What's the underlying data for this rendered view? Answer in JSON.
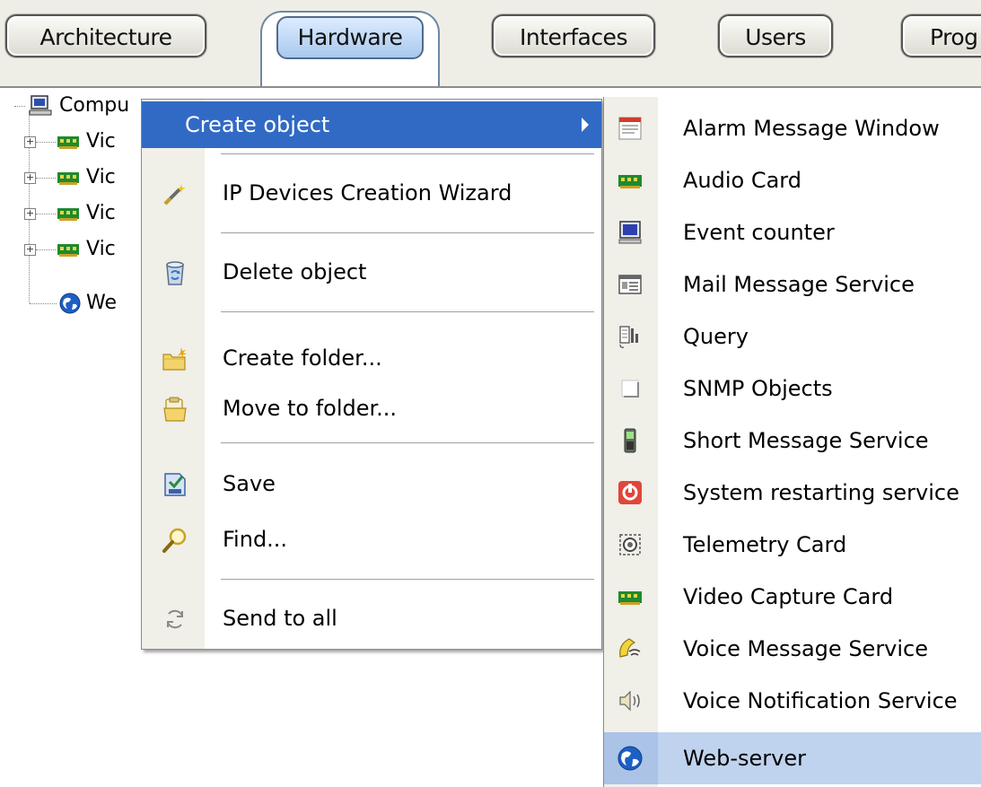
{
  "tabs": [
    {
      "label": "Architecture",
      "active": false
    },
    {
      "label": "Hardware",
      "active": true
    },
    {
      "label": "Interfaces",
      "active": false
    },
    {
      "label": "Users",
      "active": false
    },
    {
      "label": "Prog",
      "active": false
    }
  ],
  "tree": {
    "root_label": "Compu",
    "children": [
      {
        "label": "Vic",
        "icon": "video-card-icon"
      },
      {
        "label": "Vic",
        "icon": "video-card-icon"
      },
      {
        "label": "Vic",
        "icon": "video-card-icon"
      },
      {
        "label": "Vic",
        "icon": "video-card-icon"
      },
      {
        "label": "We",
        "icon": "web-server-icon"
      }
    ]
  },
  "context_menu": {
    "items": [
      {
        "label": "Create object",
        "highlighted": true,
        "has_submenu": true
      },
      {
        "label": "IP Devices Creation Wizard",
        "icon": "wizard-wand-icon"
      },
      {
        "label": "Delete object",
        "icon": "recycle-bin-icon"
      },
      {
        "label": "Create folder...",
        "icon": "new-folder-icon"
      },
      {
        "label": "Move to folder...",
        "icon": "move-folder-icon"
      },
      {
        "label": "Save",
        "icon": "save-icon"
      },
      {
        "label": "Find...",
        "icon": "magnifier-icon"
      },
      {
        "label": "Send to all",
        "icon": "sync-arrows-icon"
      }
    ]
  },
  "submenu": {
    "items": [
      {
        "label": "Alarm Message Window",
        "icon": "alarm-window-icon"
      },
      {
        "label": "Audio Card",
        "icon": "audio-card-icon"
      },
      {
        "label": "Event counter",
        "icon": "monitor-icon"
      },
      {
        "label": "Mail Message Service",
        "icon": "mail-service-icon"
      },
      {
        "label": "Query",
        "icon": "query-icon"
      },
      {
        "label": "SNMP Objects",
        "icon": "snmp-icon"
      },
      {
        "label": "Short Message Service",
        "icon": "mobile-phone-icon"
      },
      {
        "label": "System restarting service",
        "icon": "restart-icon"
      },
      {
        "label": "Telemetry Card",
        "icon": "telemetry-icon"
      },
      {
        "label": "Video Capture Card",
        "icon": "video-card-icon"
      },
      {
        "label": "Voice Message Service",
        "icon": "voice-message-icon"
      },
      {
        "label": "Voice Notification Service",
        "icon": "speaker-icon"
      },
      {
        "label": "Web-server",
        "icon": "web-server-icon",
        "highlighted": true
      }
    ]
  },
  "colors": {
    "menu_highlight": "#316ac5",
    "submenu_highlight": "#bfd3ee",
    "card_green": "#1f8a2c"
  }
}
